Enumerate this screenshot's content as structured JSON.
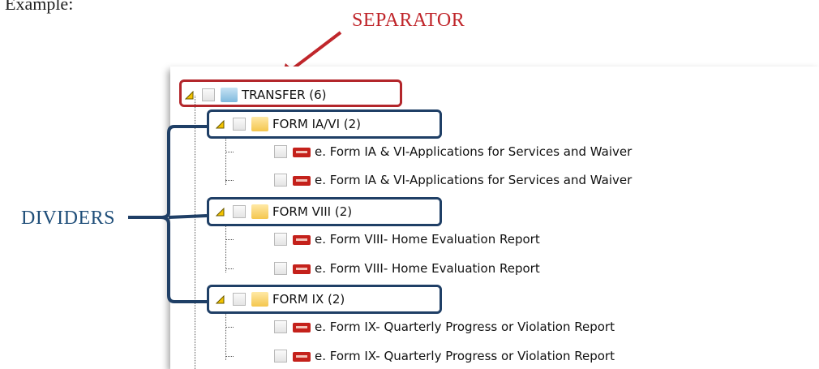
{
  "heading": "Example:",
  "annotations": {
    "separator_label": "SEPARATOR",
    "dividers_label": "DIVIDERS",
    "separator_color": "#b3262b",
    "dividers_color": "#1f3f66"
  },
  "tree": {
    "separator": {
      "label": "TRANSFER (6)",
      "icon": "folder-blue-icon"
    },
    "dividers": [
      {
        "label": "FORM IA/VI (2)",
        "children": [
          "e. Form IA & VI-Applications for Services and Waiver",
          "e. Form IA & VI-Applications for Services and Waiver"
        ]
      },
      {
        "label": "FORM VIII (2)",
        "children": [
          "e. Form VIII- Home Evaluation Report",
          "e. Form VIII- Home Evaluation Report"
        ]
      },
      {
        "label": "FORM IX (2)",
        "children": [
          "e. Form IX- Quarterly Progress or Violation Report",
          "e. Form IX- Quarterly Progress or Violation Report"
        ]
      }
    ]
  }
}
